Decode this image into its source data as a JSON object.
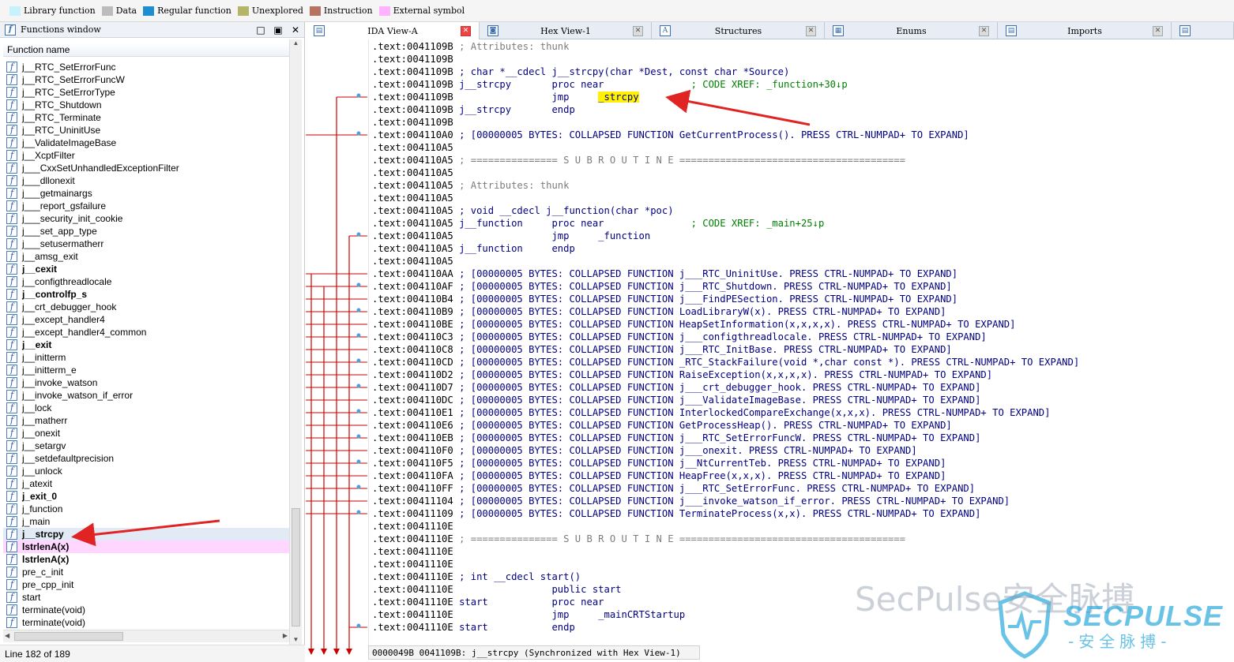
{
  "legend": [
    {
      "label": "Library function",
      "color": "#c7f1fb"
    },
    {
      "label": "Data",
      "color": "#bcbcbc"
    },
    {
      "label": "Regular function",
      "color": "#1f8ed0"
    },
    {
      "label": "Unexplored",
      "color": "#b5b56a"
    },
    {
      "label": "Instruction",
      "color": "#b77361"
    },
    {
      "label": "External symbol",
      "color": "#ffb3ff"
    }
  ],
  "functions_window": {
    "title": "Functions window",
    "column_header": "Function name",
    "status": "Line 182 of 189",
    "items": [
      {
        "name": "j__RTC_SetErrorFunc",
        "bold": false
      },
      {
        "name": "j__RTC_SetErrorFuncW",
        "bold": false
      },
      {
        "name": "j__RTC_SetErrorType",
        "bold": false
      },
      {
        "name": "j__RTC_Shutdown",
        "bold": false
      },
      {
        "name": "j__RTC_Terminate",
        "bold": false
      },
      {
        "name": "j__RTC_UninitUse",
        "bold": false
      },
      {
        "name": "j__ValidateImageBase",
        "bold": false
      },
      {
        "name": "j__XcptFilter",
        "bold": false
      },
      {
        "name": "j___CxxSetUnhandledExceptionFilter",
        "bold": false
      },
      {
        "name": "j___dllonexit",
        "bold": false
      },
      {
        "name": "j___getmainargs",
        "bold": false
      },
      {
        "name": "j___report_gsfailure",
        "bold": false
      },
      {
        "name": "j___security_init_cookie",
        "bold": false
      },
      {
        "name": "j___set_app_type",
        "bold": false
      },
      {
        "name": "j___setusermatherr",
        "bold": false
      },
      {
        "name": "j__amsg_exit",
        "bold": false
      },
      {
        "name": "j__cexit",
        "bold": true
      },
      {
        "name": "j__configthreadlocale",
        "bold": false
      },
      {
        "name": "j__controlfp_s",
        "bold": true
      },
      {
        "name": "j__crt_debugger_hook",
        "bold": false
      },
      {
        "name": "j__except_handler4",
        "bold": false
      },
      {
        "name": "j__except_handler4_common",
        "bold": false
      },
      {
        "name": "j__exit",
        "bold": true
      },
      {
        "name": "j__initterm",
        "bold": false
      },
      {
        "name": "j__initterm_e",
        "bold": false
      },
      {
        "name": "j__invoke_watson",
        "bold": false
      },
      {
        "name": "j__invoke_watson_if_error",
        "bold": false
      },
      {
        "name": "j__lock",
        "bold": false
      },
      {
        "name": "j__matherr",
        "bold": false
      },
      {
        "name": "j__onexit",
        "bold": false
      },
      {
        "name": "j__setargv",
        "bold": false
      },
      {
        "name": "j__setdefaultprecision",
        "bold": false
      },
      {
        "name": "j__unlock",
        "bold": false
      },
      {
        "name": "j_atexit",
        "bold": false
      },
      {
        "name": "j_exit_0",
        "bold": true
      },
      {
        "name": "j_function",
        "bold": false
      },
      {
        "name": "j_main",
        "bold": false
      },
      {
        "name": "j__strcpy",
        "bold": true,
        "selected": true
      },
      {
        "name": "lstrlenA(x)",
        "bold": true,
        "external": true
      },
      {
        "name": "lstrlenA(x)",
        "bold": true
      },
      {
        "name": "pre_c_init",
        "bold": false
      },
      {
        "name": "pre_cpp_init",
        "bold": false
      },
      {
        "name": "start",
        "bold": false
      },
      {
        "name": "terminate(void)",
        "bold": false
      },
      {
        "name": "terminate(void)",
        "bold": false
      }
    ]
  },
  "tabs": [
    {
      "label": "IDA View-A",
      "active": true,
      "icon": "ida-view-icon"
    },
    {
      "label": "Hex View-1",
      "active": false,
      "icon": "hex-view-icon"
    },
    {
      "label": "Structures",
      "active": false,
      "icon": "structures-icon"
    },
    {
      "label": "Enums",
      "active": false,
      "icon": "enums-icon"
    },
    {
      "label": "Imports",
      "active": false,
      "icon": "imports-icon"
    }
  ],
  "disassembly": [
    [
      ".text:0041109B ",
      {
        "t": "; Attributes: thunk",
        "c": "cmt"
      }
    ],
    [
      ".text:0041109B"
    ],
    [
      ".text:0041109B ",
      "; char *__cdecl j__strcpy(char *Dest, const char *Source)"
    ],
    [
      ".text:0041109B ",
      "j__strcpy       proc near               ",
      {
        "t": "; CODE XREF: _function+30↓p",
        "c": "xref"
      }
    ],
    [
      ".text:0041109B ",
      "                jmp     ",
      {
        "t": "_strcpy",
        "c": "hl"
      }
    ],
    [
      ".text:0041109B ",
      "j__strcpy       endp"
    ],
    [
      ".text:0041109B"
    ],
    [
      ".text:004110A0 ",
      "; [00000005 BYTES: COLLAPSED FUNCTION GetCurrentProcess(). PRESS CTRL-NUMPAD+ TO EXPAND]"
    ],
    [
      ".text:004110A5"
    ],
    [
      ".text:004110A5 ",
      {
        "t": "; =============== S U B R O U T I N E =======================================",
        "c": "cmt"
      }
    ],
    [
      ".text:004110A5"
    ],
    [
      ".text:004110A5 ",
      {
        "t": "; Attributes: thunk",
        "c": "cmt"
      }
    ],
    [
      ".text:004110A5"
    ],
    [
      ".text:004110A5 ",
      "; void __cdecl j__function(char *poc)"
    ],
    [
      ".text:004110A5 ",
      "j__function     proc near               ",
      {
        "t": "; CODE XREF: _main+25↓p",
        "c": "xref"
      }
    ],
    [
      ".text:004110A5 ",
      "                jmp     _function"
    ],
    [
      ".text:004110A5 ",
      "j__function     endp"
    ],
    [
      ".text:004110A5"
    ],
    [
      ".text:004110AA ",
      "; [00000005 BYTES: COLLAPSED FUNCTION j___RTC_UninitUse. PRESS CTRL-NUMPAD+ TO EXPAND]"
    ],
    [
      ".text:004110AF ",
      "; [00000005 BYTES: COLLAPSED FUNCTION j___RTC_Shutdown. PRESS CTRL-NUMPAD+ TO EXPAND]"
    ],
    [
      ".text:004110B4 ",
      "; [00000005 BYTES: COLLAPSED FUNCTION j___FindPESection. PRESS CTRL-NUMPAD+ TO EXPAND]"
    ],
    [
      ".text:004110B9 ",
      "; [00000005 BYTES: COLLAPSED FUNCTION LoadLibraryW(x). PRESS CTRL-NUMPAD+ TO EXPAND]"
    ],
    [
      ".text:004110BE ",
      "; [00000005 BYTES: COLLAPSED FUNCTION HeapSetInformation(x,x,x,x). PRESS CTRL-NUMPAD+ TO EXPAND]"
    ],
    [
      ".text:004110C3 ",
      "; [00000005 BYTES: COLLAPSED FUNCTION j___configthreadlocale. PRESS CTRL-NUMPAD+ TO EXPAND]"
    ],
    [
      ".text:004110C8 ",
      "; [00000005 BYTES: COLLAPSED FUNCTION j___RTC_InitBase. PRESS CTRL-NUMPAD+ TO EXPAND]"
    ],
    [
      ".text:004110CD ",
      "; [00000005 BYTES: COLLAPSED FUNCTION _RTC_StackFailure(void *,char const *). PRESS CTRL-NUMPAD+ TO EXPAND]"
    ],
    [
      ".text:004110D2 ",
      "; [00000005 BYTES: COLLAPSED FUNCTION RaiseException(x,x,x,x). PRESS CTRL-NUMPAD+ TO EXPAND]"
    ],
    [
      ".text:004110D7 ",
      "; [00000005 BYTES: COLLAPSED FUNCTION j___crt_debugger_hook. PRESS CTRL-NUMPAD+ TO EXPAND]"
    ],
    [
      ".text:004110DC ",
      "; [00000005 BYTES: COLLAPSED FUNCTION j___ValidateImageBase. PRESS CTRL-NUMPAD+ TO EXPAND]"
    ],
    [
      ".text:004110E1 ",
      "; [00000005 BYTES: COLLAPSED FUNCTION InterlockedCompareExchange(x,x,x). PRESS CTRL-NUMPAD+ TO EXPAND]"
    ],
    [
      ".text:004110E6 ",
      "; [00000005 BYTES: COLLAPSED FUNCTION GetProcessHeap(). PRESS CTRL-NUMPAD+ TO EXPAND]"
    ],
    [
      ".text:004110EB ",
      "; [00000005 BYTES: COLLAPSED FUNCTION j___RTC_SetErrorFuncW. PRESS CTRL-NUMPAD+ TO EXPAND]"
    ],
    [
      ".text:004110F0 ",
      "; [00000005 BYTES: COLLAPSED FUNCTION j___onexit. PRESS CTRL-NUMPAD+ TO EXPAND]"
    ],
    [
      ".text:004110F5 ",
      "; [00000005 BYTES: COLLAPSED FUNCTION j__NtCurrentTeb. PRESS CTRL-NUMPAD+ TO EXPAND]"
    ],
    [
      ".text:004110FA ",
      "; [00000005 BYTES: COLLAPSED FUNCTION HeapFree(x,x,x). PRESS CTRL-NUMPAD+ TO EXPAND]"
    ],
    [
      ".text:004110FF ",
      "; [00000005 BYTES: COLLAPSED FUNCTION j___RTC_SetErrorFunc. PRESS CTRL-NUMPAD+ TO EXPAND]"
    ],
    [
      ".text:00411104 ",
      "; [00000005 BYTES: COLLAPSED FUNCTION j___invoke_watson_if_error. PRESS CTRL-NUMPAD+ TO EXPAND]"
    ],
    [
      ".text:00411109 ",
      "; [00000005 BYTES: COLLAPSED FUNCTION TerminateProcess(x,x). PRESS CTRL-NUMPAD+ TO EXPAND]"
    ],
    [
      ".text:0041110E"
    ],
    [
      ".text:0041110E ",
      {
        "t": "; =============== S U B R O U T I N E =======================================",
        "c": "cmt"
      }
    ],
    [
      ".text:0041110E"
    ],
    [
      ".text:0041110E"
    ],
    [
      ".text:0041110E ",
      "; int __cdecl start()"
    ],
    [
      ".text:0041110E ",
      "                public start"
    ],
    [
      ".text:0041110E ",
      "start           proc near"
    ],
    [
      ".text:0041110E ",
      "                jmp     _mainCRTStartup"
    ],
    [
      ".text:0041110E ",
      "start           endp"
    ]
  ],
  "disasm_status": "0000049B 0041109B: j__strcpy (Synchronized with Hex View-1)",
  "watermark": {
    "text": "SecPulse安全脉搏",
    "brand": "SECPULSE",
    "sub": "-安全脉搏-"
  },
  "colors": {
    "address": "#000000",
    "code": "#000080",
    "comment": "#7d7d7d",
    "xref": "#008000",
    "highlight": "#fff100",
    "arrow": "#cc0000"
  }
}
